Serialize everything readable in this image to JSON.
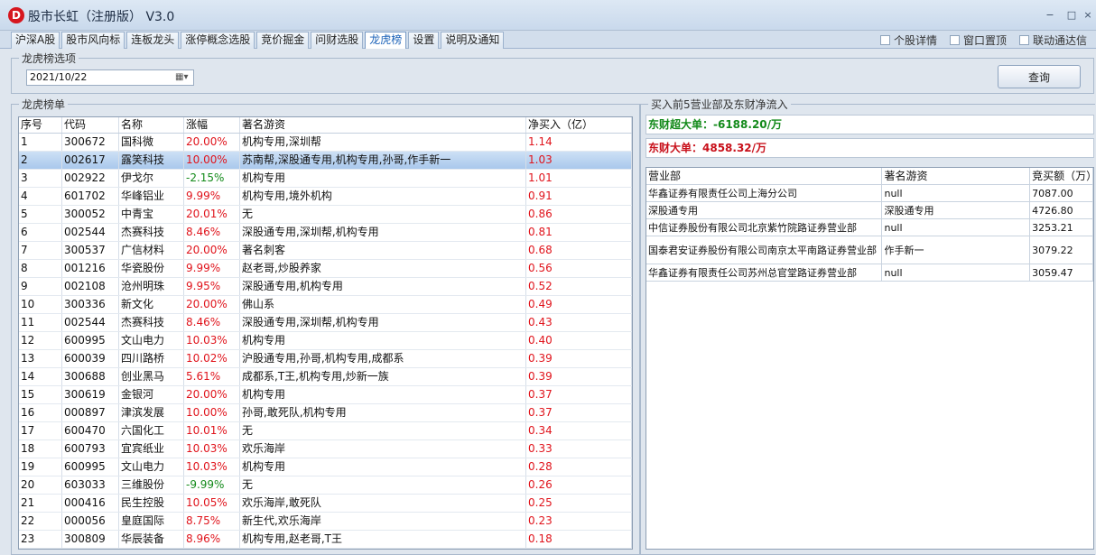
{
  "app": {
    "title": "股市长虹（注册版） V3.0",
    "logo_letter": "D"
  },
  "window_controls": [
    "−",
    "□",
    "×"
  ],
  "tabs": [
    "沪深A股",
    "股市风向标",
    "连板龙头",
    "涨停概念选股",
    "竞价掘金",
    "问财选股",
    "龙虎榜",
    "设置",
    "说明及通知"
  ],
  "active_tab": 6,
  "options": [
    "个股详情",
    "窗口置顶",
    "联动通达信"
  ],
  "selector": {
    "group_title": "龙虎榜选项",
    "date": "2021/10/22",
    "query_label": "查询"
  },
  "list": {
    "group_title": "龙虎榜单",
    "columns": [
      "序号",
      "代码",
      "名称",
      "涨幅",
      "著名游资",
      "净买入（亿）"
    ],
    "selected_row": 1,
    "rows": [
      [
        "1",
        "300672",
        "国科微",
        "20.00%",
        "机构专用,深圳帮",
        "1.14"
      ],
      [
        "2",
        "002617",
        "露笑科技",
        "10.00%",
        "苏南帮,深股通专用,机构专用,孙哥,作手新一",
        "1.03"
      ],
      [
        "3",
        "002922",
        "伊戈尔",
        "-2.15%",
        "机构专用",
        "1.01"
      ],
      [
        "4",
        "601702",
        "华峰铝业",
        "9.99%",
        "机构专用,境外机构",
        "0.91"
      ],
      [
        "5",
        "300052",
        "中青宝",
        "20.01%",
        "无",
        "0.86"
      ],
      [
        "6",
        "002544",
        "杰赛科技",
        "8.46%",
        "深股通专用,深圳帮,机构专用",
        "0.81"
      ],
      [
        "7",
        "300537",
        "广信材料",
        "20.00%",
        "著名刺客",
        "0.68"
      ],
      [
        "8",
        "001216",
        "华瓷股份",
        "9.99%",
        "赵老哥,炒股养家",
        "0.56"
      ],
      [
        "9",
        "002108",
        "沧州明珠",
        "9.95%",
        "深股通专用,机构专用",
        "0.52"
      ],
      [
        "10",
        "300336",
        "新文化",
        "20.00%",
        "佛山系",
        "0.49"
      ],
      [
        "11",
        "002544",
        "杰赛科技",
        "8.46%",
        "深股通专用,深圳帮,机构专用",
        "0.43"
      ],
      [
        "12",
        "600995",
        "文山电力",
        "10.03%",
        "机构专用",
        "0.40"
      ],
      [
        "13",
        "600039",
        "四川路桥",
        "10.02%",
        "沪股通专用,孙哥,机构专用,成都系",
        "0.39"
      ],
      [
        "14",
        "300688",
        "创业黑马",
        "5.61%",
        "成都系,T王,机构专用,炒新一族",
        "0.39"
      ],
      [
        "15",
        "300619",
        "金银河",
        "20.00%",
        "机构专用",
        "0.37"
      ],
      [
        "16",
        "000897",
        "津滨发展",
        "10.00%",
        "孙哥,敢死队,机构专用",
        "0.37"
      ],
      [
        "17",
        "600470",
        "六国化工",
        "10.01%",
        "无",
        "0.34"
      ],
      [
        "18",
        "600793",
        "宜宾纸业",
        "10.03%",
        "欢乐海岸",
        "0.33"
      ],
      [
        "19",
        "600995",
        "文山电力",
        "10.03%",
        "机构专用",
        "0.28"
      ],
      [
        "20",
        "603033",
        "三维股份",
        "-9.99%",
        "无",
        "0.26"
      ],
      [
        "21",
        "000416",
        "民生控股",
        "10.05%",
        "欢乐海岸,敢死队",
        "0.25"
      ],
      [
        "22",
        "000056",
        "皇庭国际",
        "8.75%",
        "新生代,欢乐海岸",
        "0.23"
      ],
      [
        "23",
        "300809",
        "华辰装备",
        "8.96%",
        "机构专用,赵老哥,T王",
        "0.18"
      ]
    ]
  },
  "right": {
    "group_title": "买入前5营业部及东财净流入",
    "super_label": "东财超大单：-6188.20/万",
    "big_label": "东财大单：4858.32/万",
    "columns": [
      "营业部",
      "著名游资",
      "竞买额（万）"
    ],
    "rows": [
      [
        "华鑫证券有限责任公司上海分公司",
        "null",
        "7087.00"
      ],
      [
        "深股通专用",
        "深股通专用",
        "4726.80"
      ],
      [
        "中信证券股份有限公司北京紫竹院路证券营业部",
        "null",
        "3253.21"
      ],
      [
        "国泰君安证券股份有限公司南京太平南路证券营业部",
        "作手新一",
        "3079.22"
      ],
      [
        "华鑫证券有限责任公司苏州总官堂路证券营业部",
        "null",
        "3059.47"
      ]
    ]
  },
  "colors": {
    "positive": "#e0141c",
    "negative": "#138a1a",
    "super_label": "#138a1a",
    "big_label": "#c8101a",
    "selected_row": "#b9d3f1"
  }
}
